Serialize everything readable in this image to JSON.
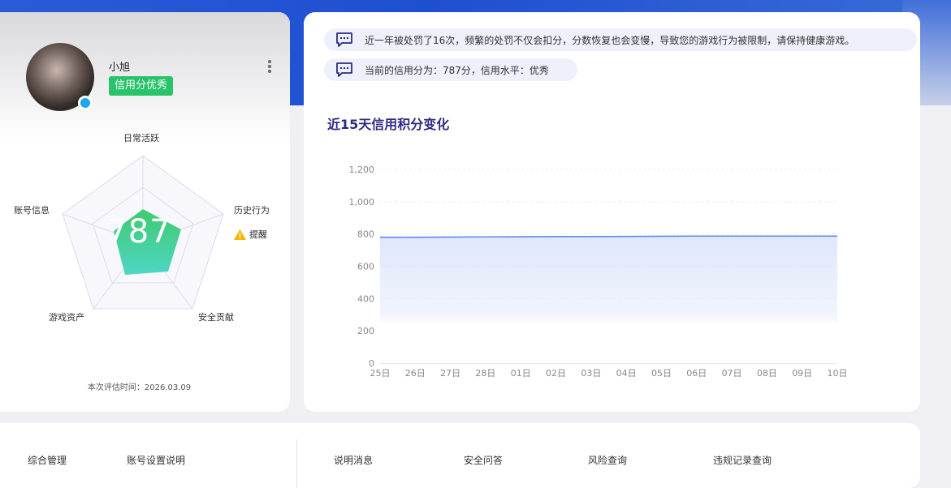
{
  "profile": {
    "username": "小旭",
    "credit_tag": "信用分优秀",
    "evaluation_time": "本次评估时间：2026.03.09",
    "score": "787",
    "radar": {
      "labels": {
        "daily": "日常活跃",
        "history": "历史行为",
        "security": "安全贡献",
        "assets": "游戏资产",
        "account": "账号信息"
      },
      "warning_label": "提醒",
      "colors": {
        "fill_top": "#3ecb6e",
        "fill_bottom": "#4fd6c6",
        "grid": "#dcdcec",
        "bg": "#f7f7fc"
      }
    }
  },
  "notices": [
    "近一年被处罚了16次，频繁的处罚不仅会扣分，分数恢复也会变慢，导致您的游戏行为被限制，请保持健康游戏。",
    "当前的信用分为：787分，信用水平：优秀"
  ],
  "chart_data": {
    "type": "area",
    "title": "近15天信用积分变化",
    "categories": [
      "25日",
      "26日",
      "27日",
      "28日",
      "01日",
      "02日",
      "03日",
      "04日",
      "05日",
      "06日",
      "07日",
      "08日",
      "09日",
      "10日"
    ],
    "series": [
      {
        "values": [
          780,
          780,
          781,
          782,
          783,
          784,
          784,
          785,
          786,
          787,
          787,
          787,
          787,
          787
        ]
      }
    ],
    "y_ticks": [
      "0",
      "200",
      "400",
      "600",
      "800",
      "1,000",
      "1,200"
    ],
    "ylim": [
      0,
      1200
    ],
    "grid": true,
    "colors": {
      "line": "#5b8de8",
      "area_top": "#dfe7fb",
      "area_bottom": "#ffffff"
    }
  },
  "bottom_tabs": [
    "综合管理",
    "账号设置说明",
    "说明消息",
    "安全问答",
    "风险查询",
    "违规记录查询"
  ]
}
